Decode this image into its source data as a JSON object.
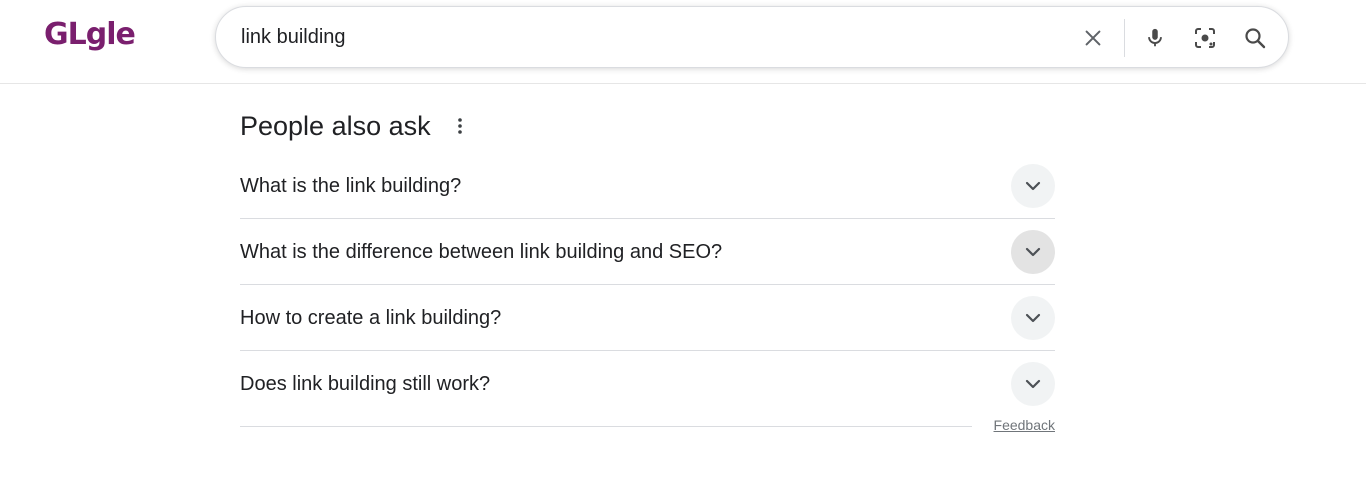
{
  "header": {
    "logo_text": "GLgle",
    "search": {
      "value": "link building",
      "placeholder": ""
    },
    "icons": {
      "clear": "close-icon",
      "voice": "microphone-icon",
      "lens": "camera-lens-icon",
      "search": "search-icon"
    }
  },
  "paa": {
    "title": "People also ask",
    "questions": [
      {
        "text": "What is the link building?"
      },
      {
        "text": "What is the difference between link building and SEO?"
      },
      {
        "text": "How to create a link building?"
      },
      {
        "text": "Does link building still work?"
      }
    ],
    "feedback_label": "Feedback"
  },
  "colors": {
    "logo": "#7a1f6e",
    "text": "#202124",
    "muted": "#70757a",
    "divider": "#dadce0",
    "chevron_bg": "#f1f3f4"
  }
}
